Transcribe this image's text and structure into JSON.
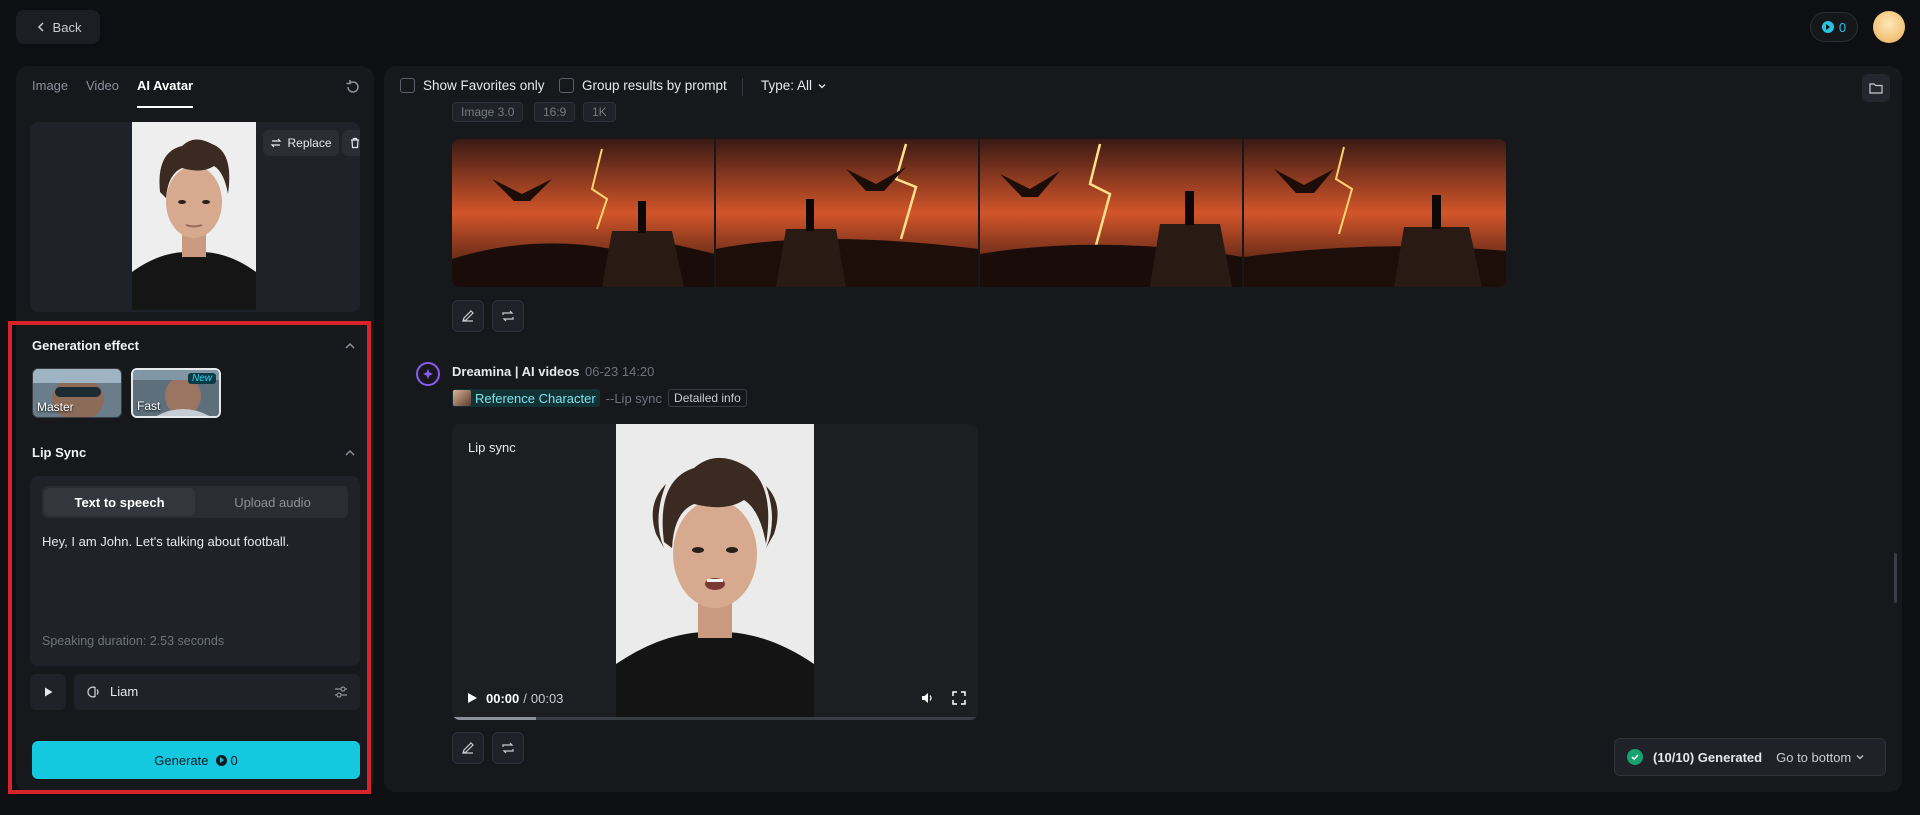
{
  "topbar": {
    "back_label": "Back",
    "credits": "0"
  },
  "left_panel": {
    "tabs": [
      {
        "label": "Image"
      },
      {
        "label": "Video"
      },
      {
        "label": "AI Avatar",
        "active": true
      }
    ],
    "upload": {
      "replace_label": "Replace"
    },
    "generation_effect": {
      "title": "Generation effect",
      "options": [
        {
          "label": "Master"
        },
        {
          "label": "Fast",
          "badge": "New",
          "selected": true
        }
      ]
    },
    "lip_sync": {
      "title": "Lip Sync",
      "modes": [
        {
          "label": "Text to speech",
          "active": true
        },
        {
          "label": "Upload audio"
        }
      ],
      "text": "Hey, I am John. Let's talking about football.",
      "duration": "Speaking duration: 2.53 seconds",
      "voice": "Liam"
    },
    "generate": {
      "label": "Generate",
      "credits": "0"
    }
  },
  "right_panel": {
    "filters": {
      "favorites_label": "Show Favorites only",
      "group_label": "Group results by prompt",
      "type_label": "Type: All"
    },
    "image_result": {
      "tags": [
        "Image 3.0",
        "16:9",
        "1K"
      ]
    },
    "video_result": {
      "source": "Dreamina | AI videos",
      "date": "06-23",
      "time": "14:20",
      "reference_label": "Reference Character",
      "mode": "--Lip sync",
      "detail_label": "Detailed info",
      "video_label": "Lip sync",
      "current_time": "00:00",
      "separator": "/",
      "duration": "00:03",
      "progress": 0.16
    },
    "status": {
      "generated": "(10/10) Generated",
      "goto_label": "Go to bottom"
    }
  },
  "colors": {
    "accent": "#14c8e0",
    "highlight": "#d8232a",
    "brand_purple": "#8a5cf6"
  }
}
